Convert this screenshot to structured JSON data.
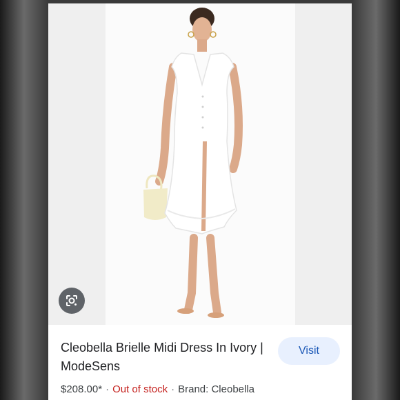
{
  "product": {
    "title": "Cleobella Brielle Midi Dress In Ivory | ModeSens",
    "price": "$208.00*",
    "stock_status": "Out of stock",
    "brand": "Brand: Cleobella",
    "visit_label": "Visit"
  },
  "icons": {
    "lens": "google-lens-icon"
  },
  "colors": {
    "visit_bg": "#e8f0fe",
    "visit_text": "#1a57b6",
    "out_of_stock": "#c5221f",
    "lens_button": "#5f6368"
  }
}
